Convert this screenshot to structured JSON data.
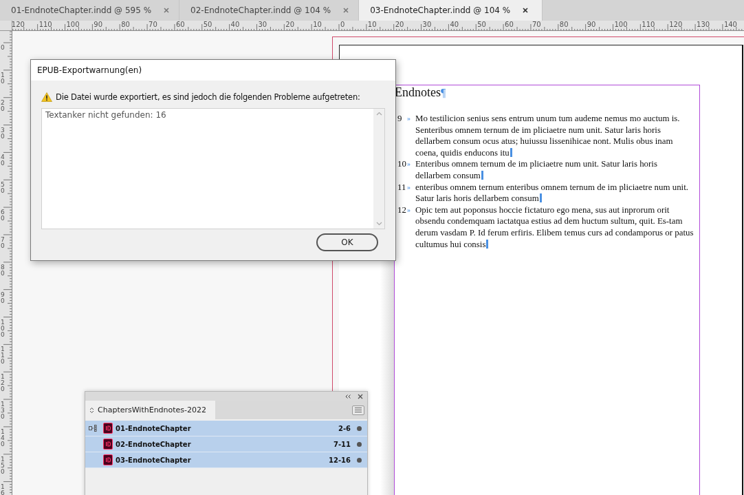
{
  "tabs": [
    {
      "label": "01-EndnoteChapter.indd @ 595 %",
      "selected": false
    },
    {
      "label": "02-EndnoteChapter.indd @ 104 %",
      "selected": false
    },
    {
      "label": "03-EndnoteChapter.indd @ 104 %",
      "selected": true
    }
  ],
  "horizontal_ruler": {
    "labels": [
      "120",
      "110",
      "100",
      "90",
      "80",
      "70",
      "60",
      "50",
      "40",
      "30",
      "20",
      "10",
      "0",
      "10",
      "20",
      "30",
      "40",
      "50",
      "60",
      "70",
      "80",
      "90",
      "100",
      "110",
      "120",
      "130",
      "140"
    ]
  },
  "vertical_ruler": {
    "labels": [
      "0",
      "10",
      "20",
      "30",
      "40",
      "50",
      "60",
      "70",
      "80",
      "90",
      "100",
      "110",
      "120",
      "130",
      "140",
      "150",
      "16"
    ]
  },
  "document": {
    "heading": "Endnotes",
    "heading_mark": "¶",
    "endnotes": [
      {
        "number": "9",
        "marker": "»",
        "text": "Mo testilicion senius sens entrum unum tum audeme nemus mo auctum is. Senteribus omnem ternum de im pliciaetre num unit. Satur laris horis dellarbem consum ocus atus; huiussu lissenihicae nont. Mulis obus inam coena, quidis enducons itu"
      },
      {
        "number": "10",
        "marker": "»",
        "text": "Enteribus omnem ternum de im pliciaetre num unit. Satur laris horis dellarbem consum"
      },
      {
        "number": "11",
        "marker": "»",
        "text": "enteribus omnem ternum enteribus omnem ternum de im pliciaetre num unit. Satur laris horis dellarbem consum"
      },
      {
        "number": "12",
        "marker": "»",
        "text": "Opic tem aut poponsus hoccie fictaturo ego mena, sus aut inprorum orit obsendu condemquam iactatqua estius ad dem huctum sultum, quit. Es-tam derum vasdam P. Id ferum erfiris. Elibem temus curs ad condamporus or patus cultumus hui consis"
      }
    ]
  },
  "dialog": {
    "title": "EPUB-Exportwarnung(en)",
    "message": "Die Datei wurde exportiert, es sind jedoch die folgenden Probleme aufgetreten:",
    "details": "Textanker nicht gefunden: 16",
    "buttons": [
      "OK"
    ]
  },
  "book_panel": {
    "tab": "ChaptersWithEndnotes-2022",
    "chapters": [
      {
        "name": "01-EndnoteChapter",
        "pages": "2-6",
        "selected": true,
        "style_source": true
      },
      {
        "name": "02-EndnoteChapter",
        "pages": "7-11",
        "selected": true,
        "style_source": false
      },
      {
        "name": "03-EndnoteChapter",
        "pages": "12-16",
        "selected": true,
        "style_source": false
      }
    ]
  }
}
